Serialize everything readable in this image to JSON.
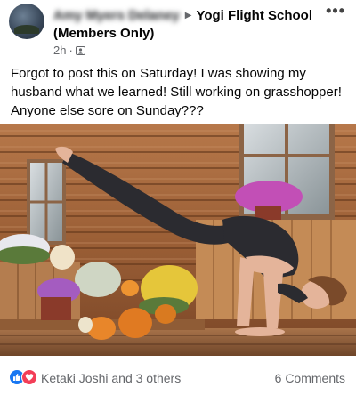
{
  "post": {
    "author_name_blurred": "Amy Myers Delaney",
    "group_name": "Yogi Flight School",
    "group_subtitle": "(Members Only)",
    "timestamp": "2h",
    "dot": "·",
    "more_label": "•••",
    "text": "Forgot to post this on Saturday! I was showing my husband what we learned! Still working on grasshopper! Anyone else sore on Sunday???"
  },
  "photo": {
    "description_icon": "yoga-photo"
  },
  "reactions": {
    "summary": "Ketaki Joshi and 3 others",
    "like_icon": "like-icon",
    "love_icon": "love-icon",
    "like_color": "#1877f2",
    "love_color": "#f33e58"
  },
  "comments": {
    "label": "6 Comments"
  }
}
